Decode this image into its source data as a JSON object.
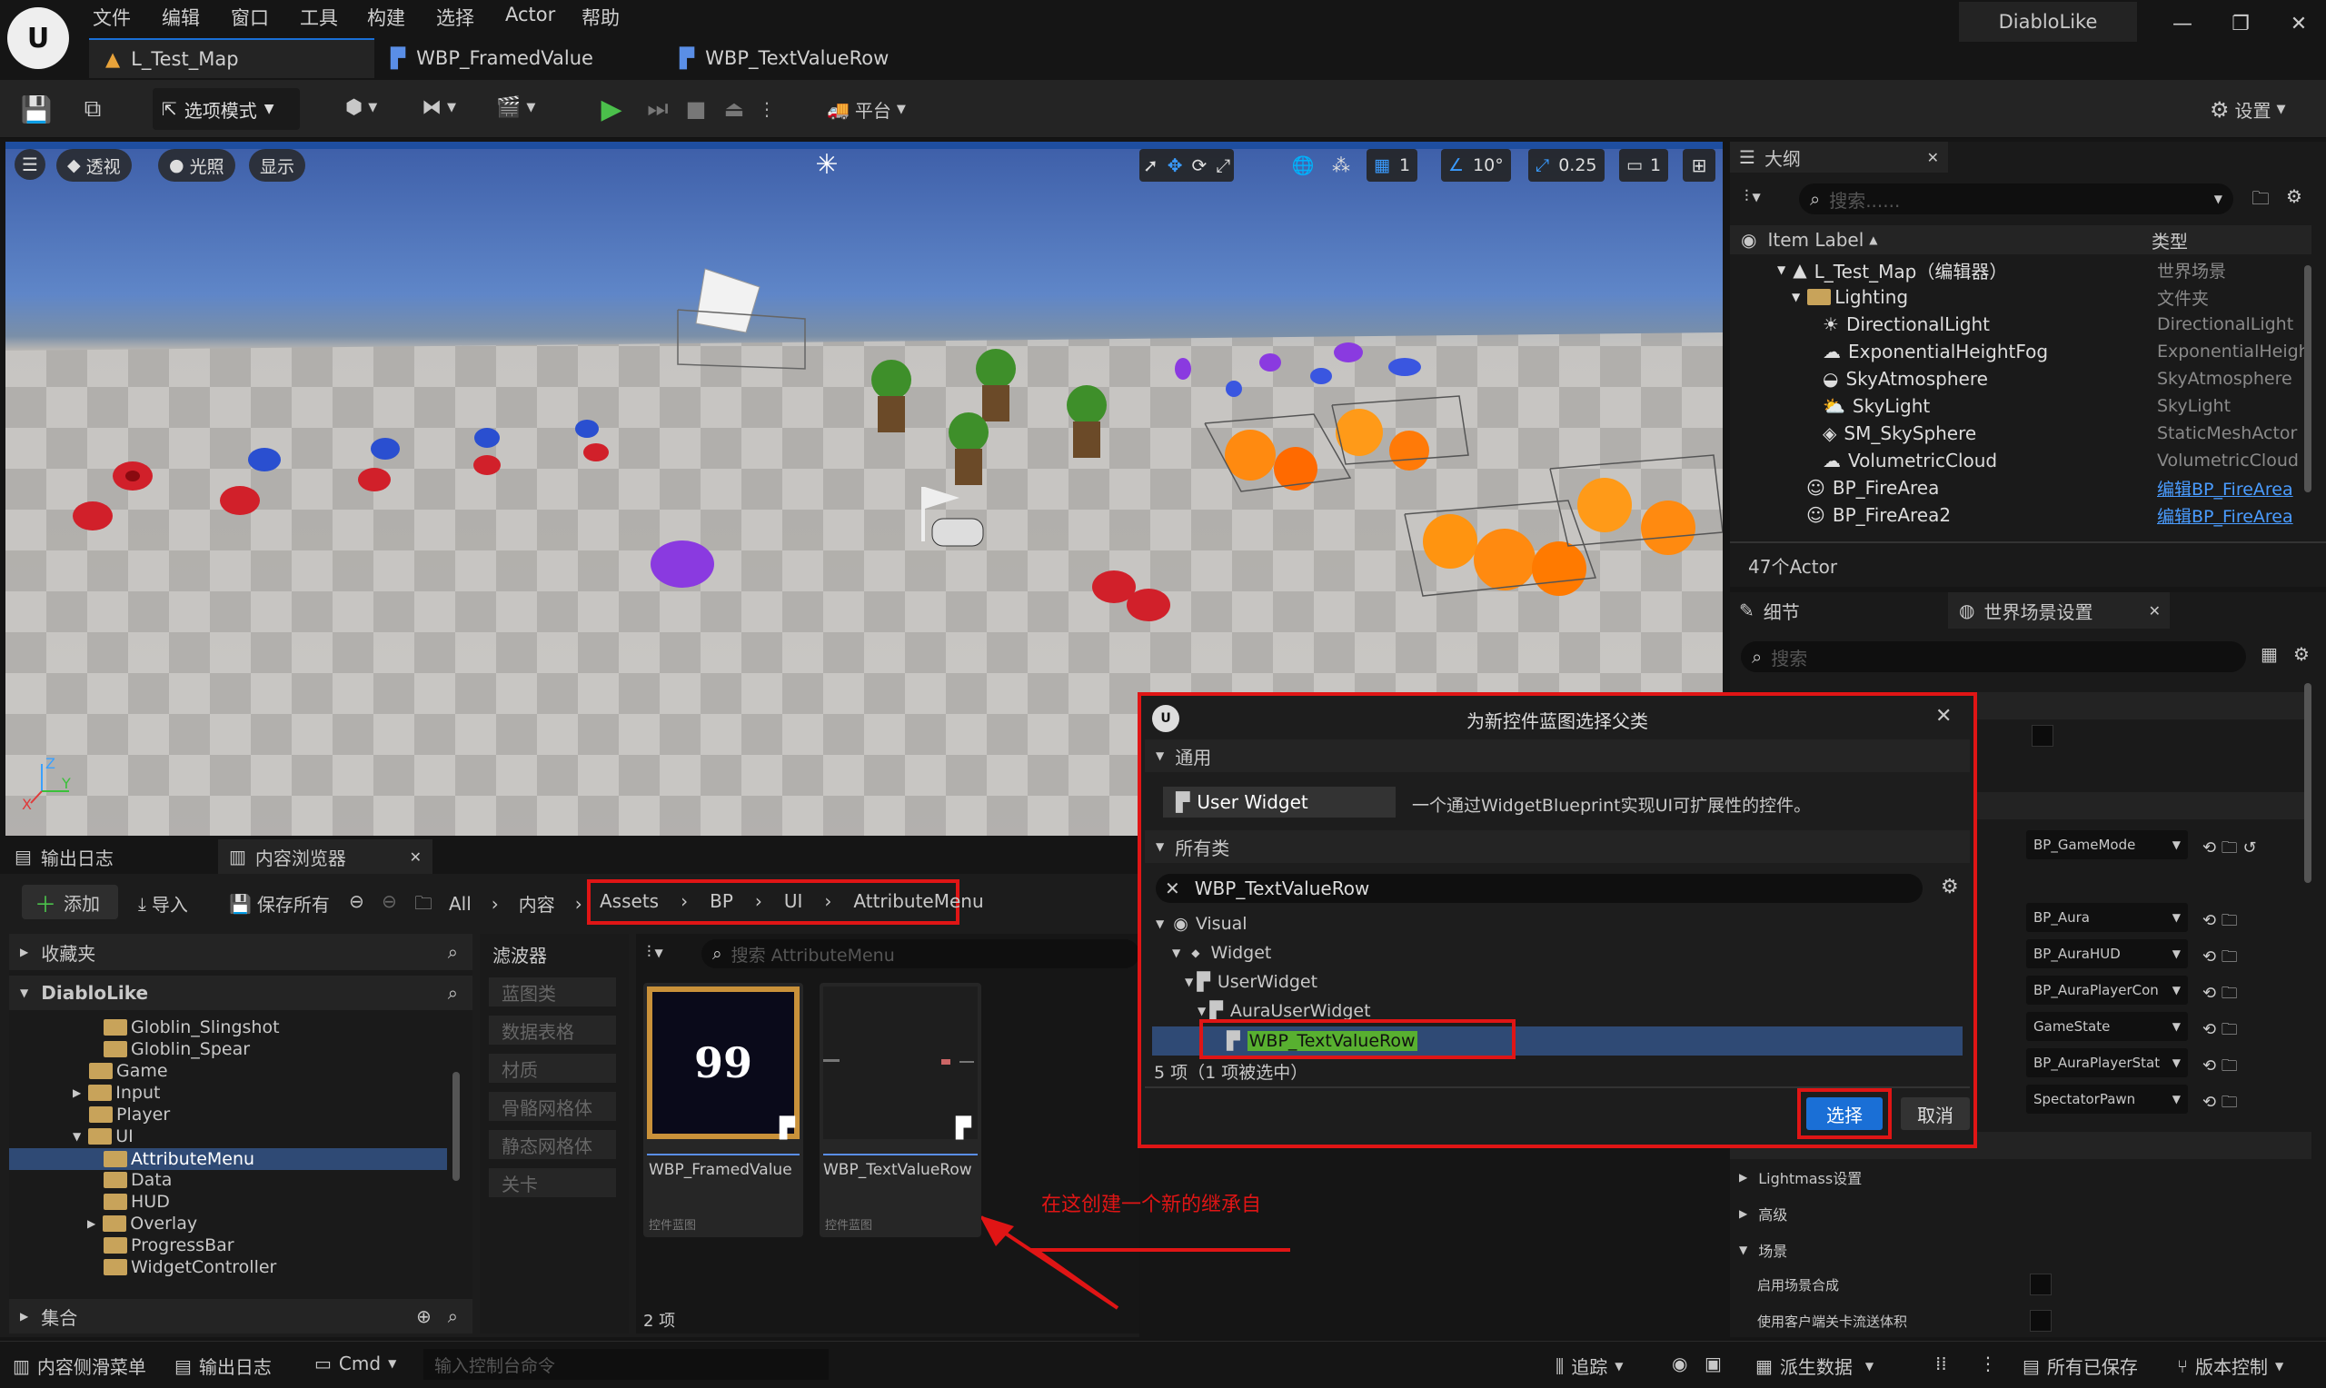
{
  "menu": [
    "文件",
    "编辑",
    "窗口",
    "工具",
    "构建",
    "选择",
    "Actor",
    "帮助"
  ],
  "project_name": "DiabloLike",
  "tabs": [
    "L_Test_Map",
    "WBP_FramedValue",
    "WBP_TextValueRow"
  ],
  "toolbar": {
    "mode_label": "选项模式",
    "platform_label": "平台",
    "settings_label": "设置"
  },
  "viewport": {
    "perspective": "透视",
    "lit": "光照",
    "show": "显示",
    "grid_snap": "1",
    "rot_snap": "10°",
    "scale_snap": "0.25",
    "cam_speed": "1"
  },
  "outliner": {
    "title": "大纲",
    "search_placeholder": "搜索......",
    "col_label": "Item Label",
    "col_type": "类型",
    "rows": [
      {
        "label": "L_Test_Map（编辑器）",
        "type": "世界场景",
        "indent": 1
      },
      {
        "label": "Lighting",
        "type": "文件夹",
        "indent": 2
      },
      {
        "label": "DirectionalLight",
        "type": "DirectionalLight",
        "indent": 3
      },
      {
        "label": "ExponentialHeightFog",
        "type": "ExponentialHeight",
        "indent": 3
      },
      {
        "label": "SkyAtmosphere",
        "type": "SkyAtmosphere",
        "indent": 3
      },
      {
        "label": "SkyLight",
        "type": "SkyLight",
        "indent": 3
      },
      {
        "label": "SM_SkySphere",
        "type": "StaticMeshActor",
        "indent": 3
      },
      {
        "label": "VolumetricCloud",
        "type": "VolumetricCloud",
        "indent": 3
      },
      {
        "label": "BP_FireArea",
        "type": "编辑BP_FireArea",
        "indent": 2,
        "link": true
      },
      {
        "label": "BP_FireArea2",
        "type": "编辑BP_FireArea",
        "indent": 2,
        "link": true
      }
    ],
    "count": "47个Actor"
  },
  "details": {
    "tab_details": "细节",
    "tab_world": "世界场景设置",
    "search_placeholder": "搜索",
    "dropdowns": [
      "BP_GameMode",
      "BP_Aura",
      "BP_AuraHUD",
      "BP_AuraPlayerCon",
      "GameState",
      "BP_AuraPlayerStat",
      "SpectatorPawn"
    ],
    "sections": [
      "Lightmass设置",
      "高级",
      "场景"
    ],
    "props": [
      "启用场景合成",
      "使用客户端关卡流送体积"
    ]
  },
  "content_browser": {
    "tab_output": "输出日志",
    "tab_cb": "内容浏览器",
    "add": "添加",
    "import": "导入",
    "save_all": "保存所有",
    "breadcrumb_pre": [
      "All",
      "内容"
    ],
    "breadcrumb": [
      "Assets",
      "BP",
      "UI",
      "AttributeMenu"
    ],
    "favorites": "收藏夹",
    "project": "DiabloLike",
    "tree": [
      {
        "label": "Globlin_Slingshot",
        "indent": 4
      },
      {
        "label": "Globlin_Spear",
        "indent": 4
      },
      {
        "label": "Game",
        "indent": 3
      },
      {
        "label": "Input",
        "indent": 3,
        "arrow": true
      },
      {
        "label": "Player",
        "indent": 3
      },
      {
        "label": "UI",
        "indent": 3,
        "open": true
      },
      {
        "label": "AttributeMenu",
        "indent": 4,
        "selected": true
      },
      {
        "label": "Data",
        "indent": 4
      },
      {
        "label": "HUD",
        "indent": 4
      },
      {
        "label": "Overlay",
        "indent": 4,
        "arrow": true
      },
      {
        "label": "ProgressBar",
        "indent": 4
      },
      {
        "label": "WidgetController",
        "indent": 4
      }
    ],
    "collections": "集合",
    "filters_title": "滤波器",
    "filters": [
      "蓝图类",
      "数据表格",
      "材质",
      "骨骼网格体",
      "静态网格体",
      "关卡"
    ],
    "search_placeholder": "搜索 AttributeMenu",
    "assets": [
      {
        "name": "WBP_FramedValue",
        "kind": "控件蓝图",
        "thumb_text": "99"
      },
      {
        "name": "WBP_TextValueRow",
        "kind": "控件蓝图",
        "thumb_text": ""
      }
    ],
    "item_count": "2 项"
  },
  "annotation": "在这创建一个新的继承自",
  "dialog": {
    "title": "为新控件蓝图选择父类",
    "common_header": "通用",
    "user_widget": "User Widget",
    "user_widget_desc": "一个通过WidgetBlueprint实现UI可扩展性的控件。",
    "all_classes_header": "所有类",
    "search_value": "WBP_TextValueRow",
    "tree": [
      {
        "label": "Visual",
        "indent": 0
      },
      {
        "label": "Widget",
        "indent": 1
      },
      {
        "label": "UserWidget",
        "indent": 2
      },
      {
        "label": "AuraUserWidget",
        "indent": 3
      },
      {
        "label": "WBP_TextValueRow",
        "indent": 4,
        "selected": true
      }
    ],
    "status": "5 项（1 项被选中）",
    "select": "选择",
    "cancel": "取消"
  },
  "statusbar": {
    "drawer": "内容侧滑菜单",
    "output": "输出日志",
    "cmd": "Cmd",
    "console_placeholder": "输入控制台命令",
    "trace": "追踪",
    "derived": "派生数据",
    "saved": "所有已保存",
    "vcs": "版本控制"
  }
}
